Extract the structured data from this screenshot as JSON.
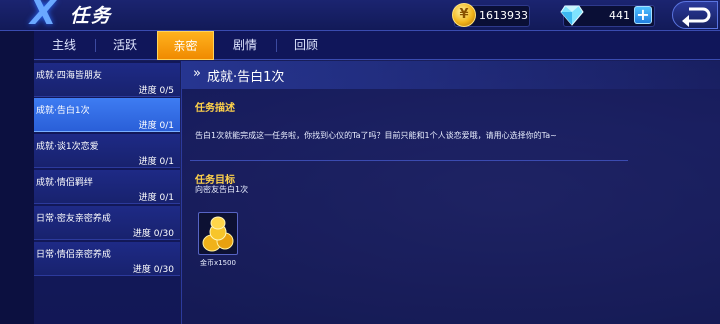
{
  "header": {
    "title": "任务",
    "gold": "1613933",
    "gems": "441"
  },
  "tabs": [
    {
      "label": "主线"
    },
    {
      "label": "活跃"
    },
    {
      "label": "亲密"
    },
    {
      "label": "剧情"
    },
    {
      "label": "回顾"
    }
  ],
  "active_tab": "亲密",
  "quests": [
    {
      "name": "成就·四海皆朋友",
      "progress": "进度 0/5"
    },
    {
      "name": "成就·告白1次",
      "progress": "进度 0/1"
    },
    {
      "name": "成就·谈1次恋爱",
      "progress": "进度 0/1"
    },
    {
      "name": "成就·情侣羁绊",
      "progress": "进度 0/1"
    },
    {
      "name": "日常·密友亲密养成",
      "progress": "进度 0/30"
    },
    {
      "name": "日常·情侣亲密养成",
      "progress": "进度 0/30"
    }
  ],
  "detail": {
    "title": "成就·告白1次",
    "desc_heading": "任务描述",
    "description": "告白1次就能完成这一任务啦，你找到心仪的Ta了吗？目前只能和1个人谈恋爱哦，请用心选择你的Ta~",
    "goal_heading": "任务目标",
    "goal": "向密友告白1次",
    "reward_label": "金币x1500"
  },
  "colors": {
    "active_tab": "#f39a10",
    "selected_item": "#3a76ee",
    "heading": "#ffd24a"
  },
  "icons": {
    "back": "x-logo-icon",
    "gold": "gold-coin-icon",
    "gem": "diamond-icon",
    "add": "plus-icon",
    "return": "return-arrow-icon",
    "reward": "gold-coins-pile-icon"
  }
}
